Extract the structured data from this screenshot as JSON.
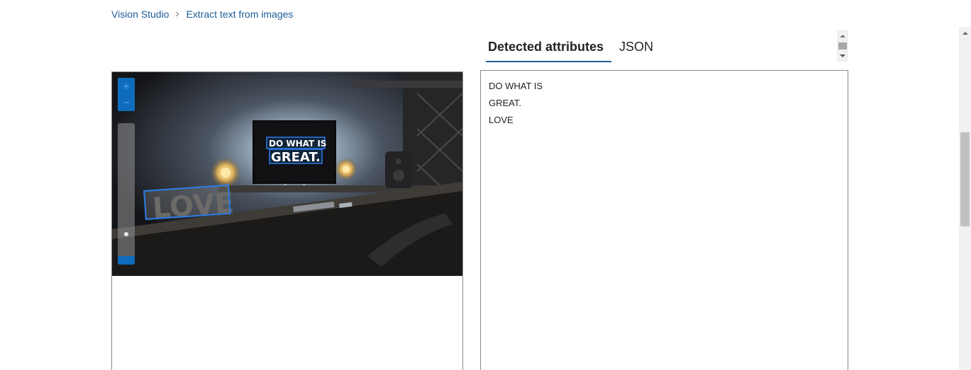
{
  "breadcrumb": {
    "items": [
      "Vision Studio",
      "Extract text from images"
    ]
  },
  "image_viewer": {
    "zoom_level": 0.08,
    "detected_overlays": [
      "DO WHAT IS",
      "GREAT.",
      "LOVE"
    ]
  },
  "tabs": {
    "active_label": "Detected attributes",
    "inactive_label": "JSON"
  },
  "results": {
    "lines": [
      "DO WHAT IS",
      "GREAT.",
      "LOVE"
    ]
  },
  "colors": {
    "accent": "#0f6cbd",
    "link": "#1c5d99",
    "ocr_box": "#2b7de9"
  },
  "icons": {
    "breadcrumb_separator": "chevron-right-icon",
    "zoom_in": "plus-icon",
    "zoom_out": "minus-icon",
    "scroll_up": "caret-up-icon",
    "scroll_down": "caret-down-icon"
  }
}
